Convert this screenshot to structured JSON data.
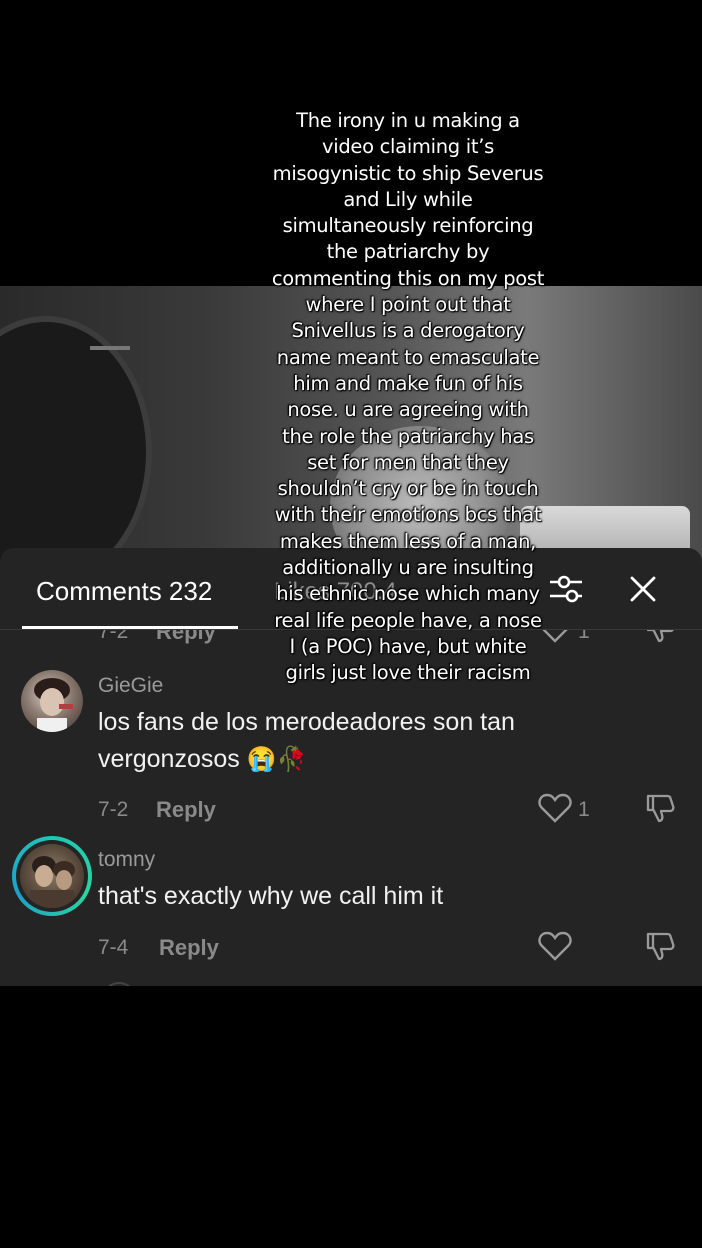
{
  "overlay": {
    "caption": "The irony in u making a video claiming it’s misogynistic to ship Severus and Lily while simultaneously reinforcing the patriarchy by commenting this on my post where I point out that Snivellus is a derogatory name meant to emasculate him and make fun of his nose. u are agreeing with the role the patriarchy has set for men that they shouldn’t cry or be in touch with their emotions bcs that makes them less of a man, additionally u are insulting his ethnic nose which many real life people have, a nose I (a POC) have, but white girls just love their racism"
  },
  "tabs": {
    "comments_label": "Comments 232",
    "likes_label": "Likes 700.4"
  },
  "icons": {
    "filter": "filter-sliders-icon",
    "close": "close-icon",
    "like": "heart-outline-icon",
    "dislike": "thumbs-down-icon"
  },
  "partial_row": {
    "date": "7-2",
    "reply": "Reply",
    "likes": "1"
  },
  "comments": [
    {
      "username": "GieGie",
      "text": "los fans de los merodeadores son tan vergonzosos",
      "emoji": "😭🥀",
      "date": "7-2",
      "reply": "Reply",
      "likes": "1"
    },
    {
      "username": "tomny",
      "text": "that's exactly why we call him it",
      "date": "7-4",
      "reply": "Reply",
      "likes": ""
    }
  ],
  "colors": {
    "panel_bg": "#242424",
    "muted_text": "#8a8a8a",
    "story_ring": "#1fc7b6"
  }
}
